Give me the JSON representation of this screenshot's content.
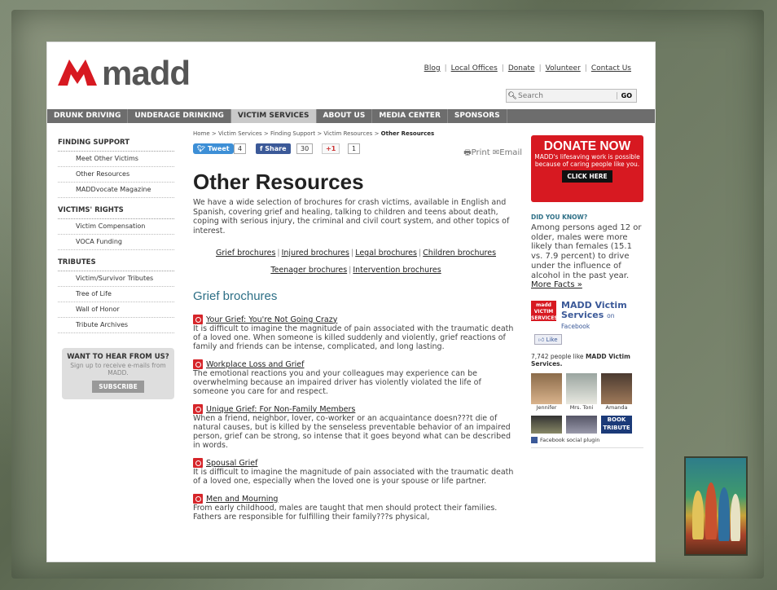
{
  "logo": {
    "text": "madd"
  },
  "toplinks": [
    "Blog",
    "Local Offices",
    "Donate",
    "Volunteer",
    "Contact Us"
  ],
  "search": {
    "placeholder": "Search",
    "go": "GO"
  },
  "nav": [
    "DRUNK DRIVING",
    "UNDERAGE DRINKING",
    "VICTIM SERVICES",
    "ABOUT US",
    "MEDIA CENTER",
    "SPONSORS"
  ],
  "sidebar": {
    "sections": [
      {
        "title": "FINDING SUPPORT",
        "items": [
          "Meet Other Victims",
          "Other Resources",
          "MADDvocate Magazine"
        ]
      },
      {
        "title": "VICTIMS' RIGHTS",
        "items": [
          "Victim Compensation",
          "VOCA Funding"
        ]
      },
      {
        "title": "TRIBUTES",
        "items": [
          "Victim/Survivor Tributes",
          "Tree of Life",
          "Wall of Honor",
          "Tribute Archives"
        ]
      }
    ],
    "want": {
      "title": "WANT TO HEAR FROM US?",
      "sub": "Sign up to receive e-mails from MADD.",
      "button": "SUBSCRIBE"
    }
  },
  "breadcrumb": [
    "Home",
    "Victim Services",
    "Finding Support",
    "Victim Resources",
    "Other Resources"
  ],
  "social": {
    "tweet": "Tweet",
    "tweet_count": "4",
    "share": "Share",
    "share_count": "30",
    "gplus": "+1",
    "gplus_count": "1",
    "print": "Print",
    "email": "Email"
  },
  "main": {
    "title": "Other Resources",
    "intro": "We have a wide selection of brochures for crash victims, available in English and Spanish, covering grief and healing, talking to children and teens about death, coping with serious injury, the criminal and civil court system, and other topics of interest.",
    "links_row1": [
      "Grief brochures",
      "Injured brochures",
      "Legal brochures",
      "Children brochures"
    ],
    "links_row2": [
      "Teenager brochures",
      "Intervention brochures"
    ],
    "section_title": "Grief brochures",
    "docs": [
      {
        "title": "Your Grief: You're Not Going Crazy",
        "desc": "It is difficult to imagine the magnitude of pain associated with the traumatic death of a loved one. When someone is killed suddenly and violently, grief reactions of family and friends can be intense, complicated, and long lasting."
      },
      {
        "title": "Workplace Loss and Grief",
        "desc": "The emotional reactions you and your colleagues may experience can be overwhelming because an impaired driver has violently violated the life of someone you care for and respect."
      },
      {
        "title": "Unique Grief: For Non-Family Members",
        "desc": "When a friend, neighbor, lover, co-worker or an acquaintance doesn???t die of natural causes, but is killed by the senseless preventable behavior of an impaired person, grief can be strong, so intense that it goes beyond what can be described in words."
      },
      {
        "title": "Spousal Grief",
        "desc": "It is difficult to imagine the magnitude of pain associated with the traumatic death of a loved one, especially when the loved one is your spouse or life partner."
      },
      {
        "title": "Men and Mourning",
        "desc": "From early childhood, males are taught that men should protect their families. Fathers are responsible for fulfilling their family???s physical,"
      }
    ]
  },
  "donate": {
    "title": "DONATE NOW",
    "text": "MADD's lifesaving work is possible because of caring people like you.",
    "cta": "CLICK HERE"
  },
  "did_you_know": {
    "title": "DID YOU KNOW?",
    "text": "Among persons aged 12 or older, males were more likely than females (15.1 vs. 7.9 percent) to drive under the influence of alcohol in the past year.",
    "more": "More Facts »"
  },
  "facebook": {
    "logo": "madd VICTIM SERVICES",
    "name": "MADD Victim Services",
    "on": "on Facebook",
    "like": "Like",
    "people_count": "7,742",
    "people_text": "people like",
    "people_name": "MADD Victim Services.",
    "faces": [
      "Jennifer",
      "Mrs. Toni",
      "Amanda"
    ],
    "tribute": "BOOK TRIBUTE",
    "plugin": "Facebook social plugin"
  },
  "colors": {
    "brand_red": "#d71921",
    "nav_gray": "#6d6d6d",
    "link_teal": "#2d6f86",
    "fb_blue": "#3b5998"
  }
}
